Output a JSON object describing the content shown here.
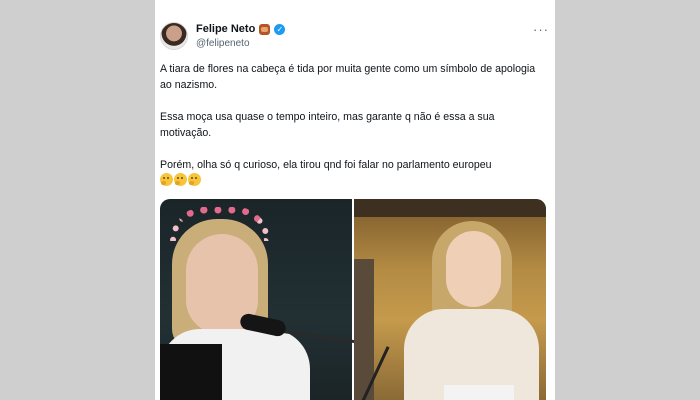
{
  "tweet": {
    "author": {
      "display_name": "Felipe Neto",
      "handle": "@felipeneto",
      "verified": true
    },
    "more_icon": "more-horizontal-icon",
    "more_glyph": "···",
    "text": {
      "paragraph1": "A tiara de flores na cabeça é tida por muita gente como um símbolo de apologia ao nazismo.",
      "paragraph2": "Essa moça usa quase o tempo inteiro, mas garante q não é essa a sua motivação.",
      "paragraph3": "Porém, olha só q curioso, ela tirou qnd foi falar no parlamento europeu"
    },
    "emojis": [
      "thinking-face",
      "thinking-face",
      "thinking-face"
    ],
    "media": {
      "left_photo": "woman-with-flower-crown-at-microphone",
      "right_photo": "woman-speaking-in-parliament"
    },
    "colors": {
      "verified": "#1d9bf0",
      "text": "#0f1419",
      "secondary": "#536471"
    }
  }
}
